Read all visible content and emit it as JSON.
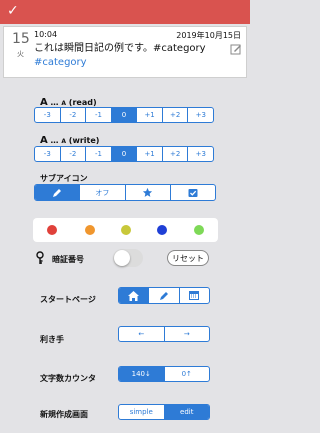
{
  "header": {
    "check_icon": "check-icon",
    "color": "#d9534f"
  },
  "entry": {
    "day": "15",
    "weekday": "火",
    "time": "10:04",
    "date": "2019年10月15日",
    "text": "これは瞬間日記の例です。#category",
    "tag": "#category"
  },
  "read": {
    "label_big": "A",
    "label_dots": "…",
    "label_small": "A",
    "label_mode": "(read)",
    "options": [
      "-3",
      "-2",
      "-1",
      "0",
      "+1",
      "+2",
      "+3"
    ],
    "selected": "0"
  },
  "write": {
    "label_big": "A",
    "label_dots": "…",
    "label_small": "A",
    "label_mode": "(write)",
    "options": [
      "-3",
      "-2",
      "-1",
      "0",
      "+1",
      "+2",
      "+3"
    ],
    "selected": "0"
  },
  "sub_icon": {
    "label": "サブアイコン",
    "off_label": "オフ",
    "icons": [
      "pencil-icon",
      "star-icon",
      "checkbox-icon"
    ],
    "selected": "pencil-icon"
  },
  "colors": [
    "#e0413a",
    "#f0962e",
    "#c8c83a",
    "#1f3fd6",
    "#7ed957"
  ],
  "passcode": {
    "label": "暗証番号",
    "enabled": false,
    "reset_label": "リセット"
  },
  "start_page": {
    "label": "スタートページ",
    "icons": [
      "home-icon",
      "pencil-icon",
      "calendar-icon"
    ],
    "selected": "home-icon"
  },
  "handedness": {
    "label": "利き手",
    "options": [
      "←",
      "→"
    ]
  },
  "char_counter": {
    "label": "文字数カウンタ",
    "options": [
      "140↓",
      "0↑"
    ],
    "selected": "140↓"
  },
  "new_screen": {
    "label": "新規作成画面",
    "options": [
      "simple",
      "edit"
    ],
    "selected": "edit"
  }
}
